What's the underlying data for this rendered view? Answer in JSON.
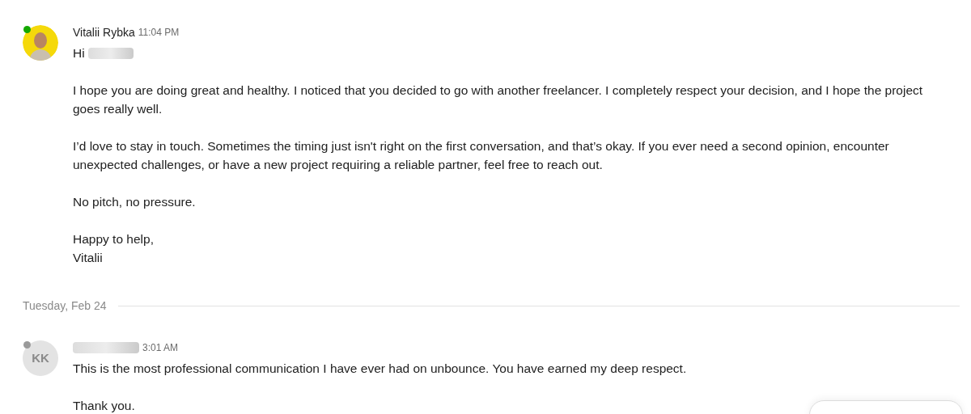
{
  "feed": [
    {
      "kind": "message",
      "online": true,
      "author": {
        "name": "Vitalii Rybka",
        "redacted": false
      },
      "time": "11:04 PM",
      "paragraphs": [
        {
          "text": "Hi",
          "redacted_after": true
        },
        {
          "text": "I hope you are doing great and healthy. I noticed that you decided to go with another freelancer. I completely respect your decision, and I hope the project goes really well.",
          "redacted_after": false
        },
        {
          "text": "I’d love to stay in touch. Sometimes the timing just isn't right on the first conversation, and that’s okay. If you ever need a second opinion, encounter unexpected challenges, or have a new project requiring a reliable partner, feel free to reach out.",
          "redacted_after": false
        },
        {
          "text": "No pitch, no pressure.",
          "redacted_after": false
        },
        {
          "text": "Happy to help,\nVitalii",
          "redacted_after": false
        }
      ]
    },
    {
      "kind": "date_divider",
      "label": "Tuesday, Feb 24"
    },
    {
      "kind": "message",
      "online": false,
      "avatar": {
        "kind": "initials",
        "initials": "KK"
      },
      "author": {
        "redacted": true
      },
      "time": "3:01 AM",
      "paragraphs": [
        {
          "text": "This is the most professional communication I have ever had on unbounce. You have earned my deep respect.",
          "redacted_after": false
        },
        {
          "text": "Thank you.",
          "redacted_after": false
        }
      ]
    }
  ]
}
